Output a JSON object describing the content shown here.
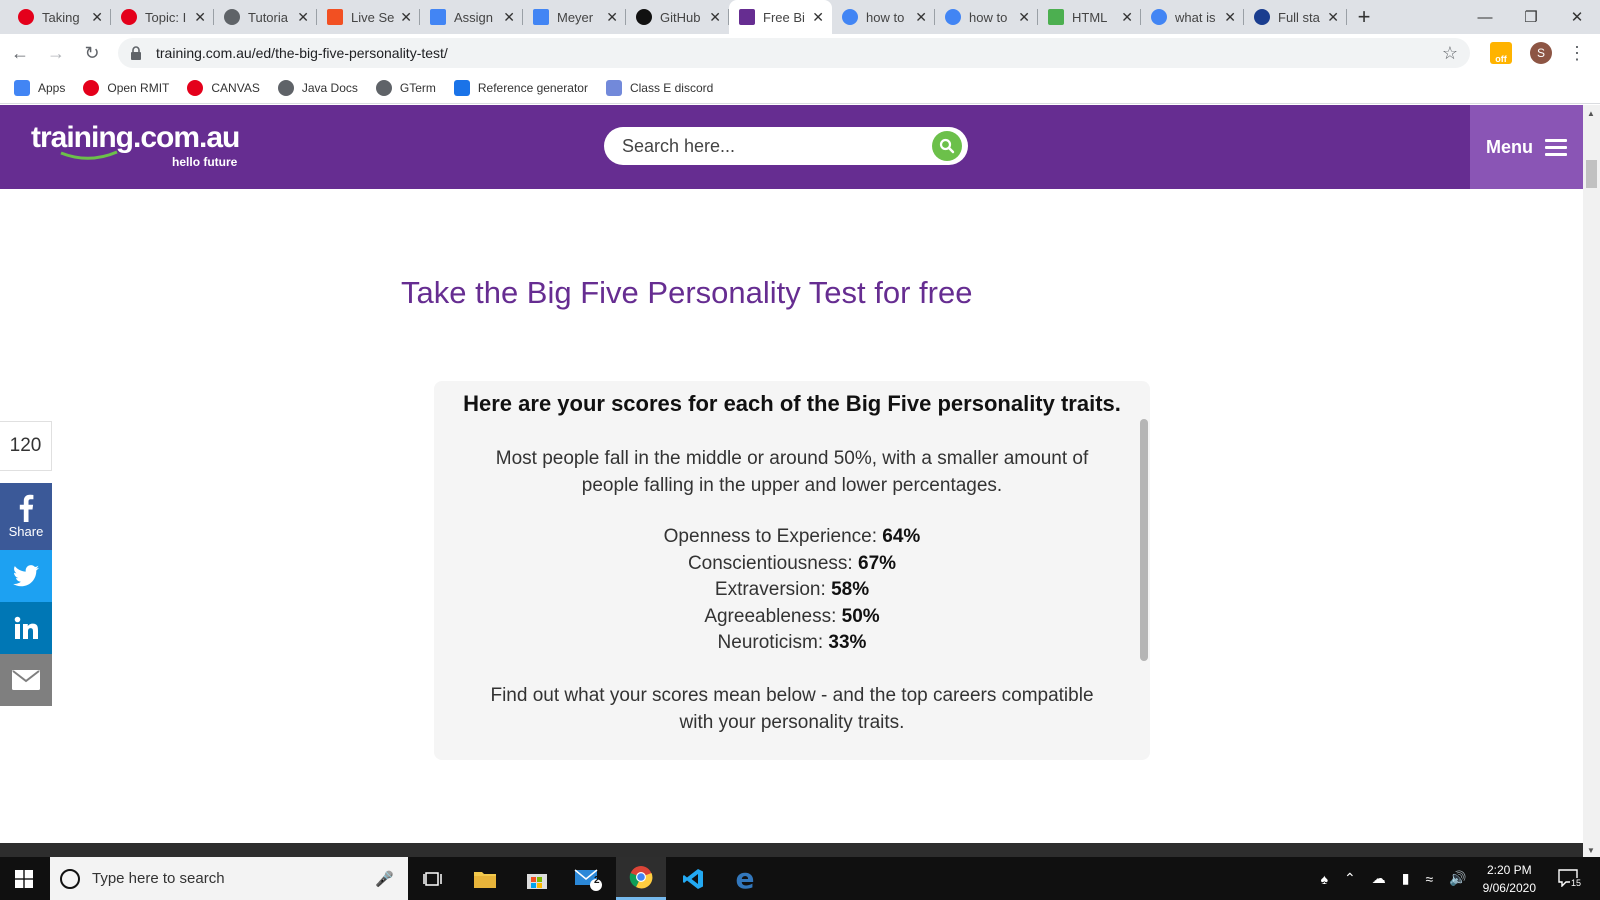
{
  "browser": {
    "tabs": [
      {
        "title": "Taking",
        "icon": "rmit-red-icon",
        "color": "#e4001b"
      },
      {
        "title": "Topic: I",
        "icon": "rmit-red-icon",
        "color": "#e4001b"
      },
      {
        "title": "Tutoria",
        "icon": "globe-icon",
        "color": "#5f6368"
      },
      {
        "title": "Live Se",
        "icon": "microsoft-icon",
        "color": "#f25022"
      },
      {
        "title": "Assign",
        "icon": "google-docs-icon",
        "color": "#4285f4"
      },
      {
        "title": "Meyer",
        "icon": "google-docs-icon",
        "color": "#4285f4"
      },
      {
        "title": "GitHub",
        "icon": "github-icon",
        "color": "#111111"
      },
      {
        "title": "Free Bi",
        "icon": "training-icon",
        "color": "#662d91"
      },
      {
        "title": "how to",
        "icon": "google-icon",
        "color": "#4285f4"
      },
      {
        "title": "how to",
        "icon": "google-icon",
        "color": "#4285f4"
      },
      {
        "title": "HTML",
        "icon": "w3-icon",
        "color": "#4caf50"
      },
      {
        "title": "what is",
        "icon": "google-icon",
        "color": "#4285f4"
      },
      {
        "title": "Full sta",
        "icon": "globe-blue-icon",
        "color": "#1a3d8f"
      }
    ],
    "active_tab": 7,
    "new_tab_label": "+",
    "url": "training.com.au/ed/the-big-five-personality-test/",
    "extension_badge": "off",
    "profile_initial": "S",
    "bookmarks": [
      {
        "label": "Apps",
        "icon": "apps-grid-icon",
        "color": "#4285f4"
      },
      {
        "label": "Open RMIT",
        "icon": "rmit-red-icon",
        "color": "#e4001b"
      },
      {
        "label": "CANVAS",
        "icon": "rmit-red-icon",
        "color": "#e4001b"
      },
      {
        "label": "Java Docs",
        "icon": "globe-icon",
        "color": "#5f6368"
      },
      {
        "label": "GTerm",
        "icon": "globe-icon",
        "color": "#5f6368"
      },
      {
        "label": "Reference generator",
        "icon": "bookmark-page-icon",
        "color": "#1a73e8"
      },
      {
        "label": "Class E discord",
        "icon": "discord-icon",
        "color": "#7289da"
      }
    ]
  },
  "site": {
    "logo_text": "training.com.au",
    "logo_tagline": "hello future",
    "search_placeholder": "Search here...",
    "menu_label": "Menu",
    "brand_color": "#662d91",
    "accent_color": "#6cc04a"
  },
  "share": {
    "count": "120",
    "facebook_label": "Share"
  },
  "content": {
    "page_title": "Take the Big Five Personality Test for free",
    "heading": "Here are your scores for each of the Big Five personality traits.",
    "intro": "Most people fall in the middle or around 50%, with a smaller amount of people falling in the upper and lower percentages.",
    "traits": [
      {
        "name": "Openness to Experience:",
        "score": "64%"
      },
      {
        "name": "Conscientiousness:",
        "score": "67%"
      },
      {
        "name": "Extraversion:",
        "score": "58%"
      },
      {
        "name": "Agreeableness:",
        "score": "50%"
      },
      {
        "name": "Neuroticism:",
        "score": "33%"
      }
    ],
    "outro": "Find out what your scores mean below - and the top careers compatible with your personality traits."
  },
  "taskbar": {
    "search_placeholder": "Type here to search",
    "mail_badge": "2",
    "time": "2:20 PM",
    "date": "9/06/2020",
    "notification_count": "15"
  }
}
